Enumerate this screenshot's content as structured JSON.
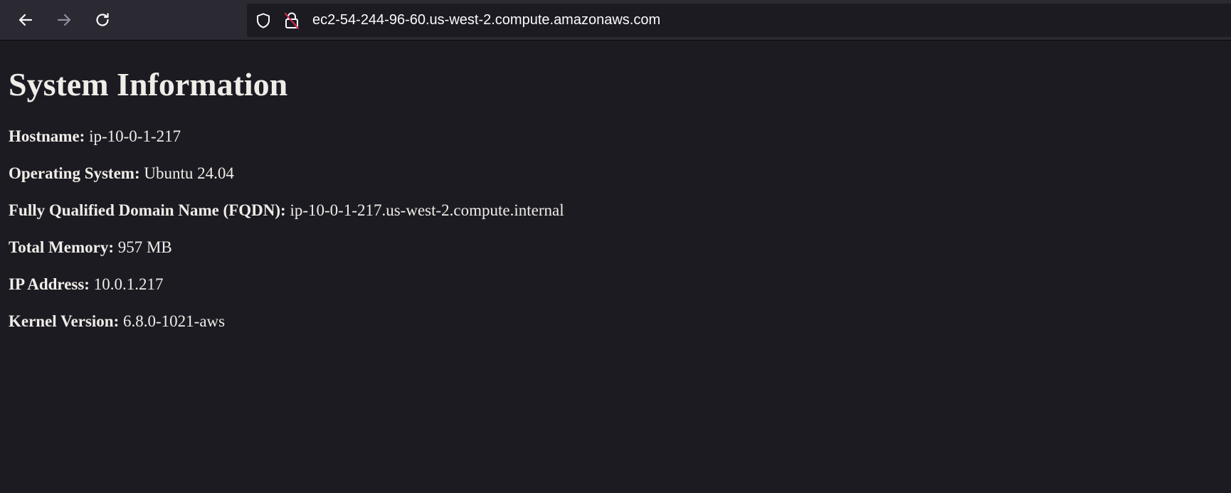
{
  "browser": {
    "url": "ec2-54-244-96-60.us-west-2.compute.amazonaws.com",
    "icons": {
      "back": "arrow-left-icon",
      "forward": "arrow-right-icon",
      "reload": "reload-icon",
      "tracking": "shield-icon",
      "security": "insecure-lock-icon"
    }
  },
  "page": {
    "title": "System Information",
    "rows": [
      {
        "label": "Hostname:",
        "value": "ip-10-0-1-217"
      },
      {
        "label": "Operating System:",
        "value": "Ubuntu 24.04"
      },
      {
        "label": "Fully Qualified Domain Name (FQDN):",
        "value": "ip-10-0-1-217.us-west-2.compute.internal"
      },
      {
        "label": "Total Memory:",
        "value": "957 MB"
      },
      {
        "label": "IP Address:",
        "value": "10.0.1.217"
      },
      {
        "label": "Kernel Version:",
        "value": "6.8.0-1021-aws"
      }
    ]
  },
  "colors": {
    "page_background": "#1c1b22",
    "toolbar_background": "#2b2a33",
    "text": "#f0ede8",
    "insecure_accent": "#e22850"
  }
}
